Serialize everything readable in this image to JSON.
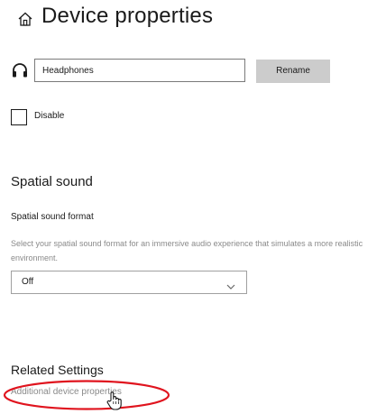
{
  "header": {
    "title": "Device properties",
    "icon": "home-icon"
  },
  "device": {
    "icon": "headphones-icon",
    "name_value": "Headphones",
    "rename_label": "Rename"
  },
  "disable": {
    "label": "Disable",
    "checked": false
  },
  "spatial_sound": {
    "heading": "Spatial sound",
    "format_label": "Spatial sound format",
    "description": "Select your spatial sound format for an immersive audio experience that simulates a more realistic environment.",
    "selected_value": "Off",
    "chevron_icon": "chevron-down-icon"
  },
  "related_settings": {
    "heading": "Related Settings",
    "link_label": "Additional device properties"
  },
  "annotation": {
    "highlight_color": "#e0141e",
    "cursor_icon": "hand-cursor-icon"
  }
}
